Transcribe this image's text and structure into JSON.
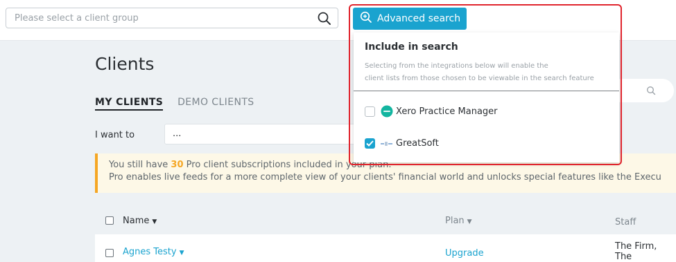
{
  "colors": {
    "accent": "#1aa3cf",
    "warning": "#f5a623",
    "highlight_border": "#e0242d",
    "xero_green": "#13b5a0"
  },
  "top": {
    "client_group_placeholder": "Please select a client group",
    "advanced_search_label": "Advanced search"
  },
  "page": {
    "title": "Clients",
    "tabs": [
      {
        "label": "MY CLIENTS",
        "active": true
      },
      {
        "label": "DEMO CLIENTS",
        "active": false
      }
    ],
    "want_to_label": "I want to",
    "want_to_value": "...",
    "banner": {
      "line1_prefix": "You still have ",
      "count": "30",
      "line1_suffix": " Pro client subscriptions included in your plan.",
      "line2": "Pro enables live feeds for a more complete view of your clients' financial world and unlocks special features like the Execu"
    },
    "table": {
      "columns": [
        {
          "label": "Name",
          "sortable": true
        },
        {
          "label": "Plan",
          "sortable": true
        },
        {
          "label": "Staff",
          "sortable": false
        }
      ],
      "rows": [
        {
          "name": "Agnes Testy",
          "plan": "Upgrade",
          "staff": "The Firm, The"
        }
      ]
    }
  },
  "dropdown": {
    "title": "Include in search",
    "description_line1": "Selecting from the integrations below will enable the",
    "description_line2": "client lists from those chosen to be viewable in the search feature",
    "items": [
      {
        "label": "Xero Practice Manager",
        "checked": false,
        "icon": "xero-logo-icon"
      },
      {
        "label": "GreatSoft",
        "checked": true,
        "icon": "greatsoft-logo-icon"
      }
    ]
  }
}
